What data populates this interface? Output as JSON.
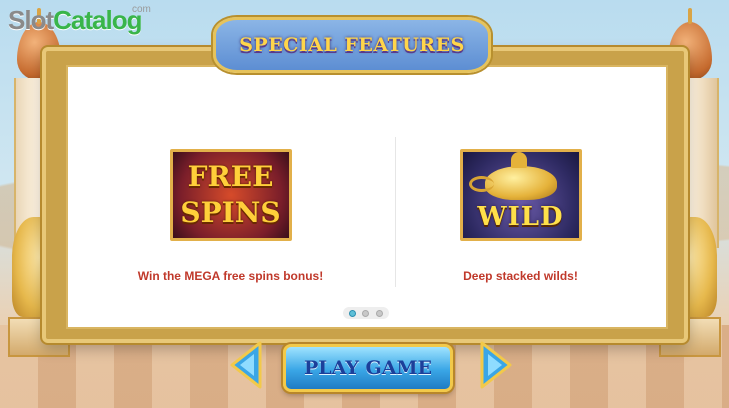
{
  "logo": {
    "part1": "Slot",
    "part2": "Catalog",
    "suffix": "com"
  },
  "banner": {
    "title": "SPECIAL FEATURES"
  },
  "features": [
    {
      "image_lines": [
        "FREE",
        "SPINS"
      ],
      "caption": "Win the MEGA free spins bonus!"
    },
    {
      "image_text": "WILD",
      "caption": "Deep stacked wilds!"
    }
  ],
  "pagination": {
    "total_pages": 3,
    "current_page": 1
  },
  "controls": {
    "play_label": "PLAY GAME",
    "prev_icon": "arrow-left-icon",
    "next_icon": "arrow-right-icon"
  },
  "colors": {
    "caption": "#c0392b",
    "title_gold": "#ffd54a",
    "button_blue": "#3aa6e6",
    "frame_gold": "#e2b04a"
  }
}
